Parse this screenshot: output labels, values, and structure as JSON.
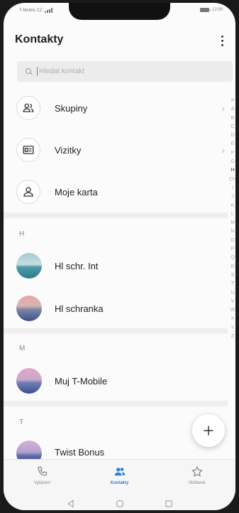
{
  "status_bar": {
    "carrier": "T-Mobile CZ",
    "time": "12:00"
  },
  "header": {
    "title": "Kontakty"
  },
  "search": {
    "placeholder": "Hledat kontakt"
  },
  "menu_items": [
    {
      "label": "Skupiny",
      "icon": "group-icon",
      "has_chevron": true
    },
    {
      "label": "Vizitky",
      "icon": "business-card-icon",
      "has_chevron": true
    },
    {
      "label": "Moje karta",
      "icon": "person-icon",
      "has_chevron": false
    }
  ],
  "sections": [
    {
      "header": "H",
      "contacts": [
        "Hl schr. Int",
        "Hl schranka"
      ]
    },
    {
      "header": "M",
      "contacts": [
        "Muj T-Mobile"
      ]
    },
    {
      "header": "T",
      "contacts": [
        "Twist Bonus"
      ]
    }
  ],
  "alphabet_index": {
    "letters": [
      "#",
      "A",
      "B",
      "C",
      "D",
      "E",
      "F",
      "G",
      "H",
      "CH",
      "I",
      "J",
      "K",
      "L",
      "M",
      "N",
      "O",
      "P",
      "Q",
      "R",
      "S",
      "T",
      "U",
      "V",
      "W",
      "X",
      "Y",
      "Z"
    ],
    "active": "H"
  },
  "bottom_nav": [
    {
      "label": "Vytáčení",
      "icon": "phone-icon",
      "active": false
    },
    {
      "label": "Kontakty",
      "icon": "contacts-icon",
      "active": true
    },
    {
      "label": "Oblíbené",
      "icon": "star-icon",
      "active": false
    }
  ],
  "colors": {
    "accent": "#2a7fd6",
    "background": "#fbfbfb",
    "divider": "#efefef"
  }
}
